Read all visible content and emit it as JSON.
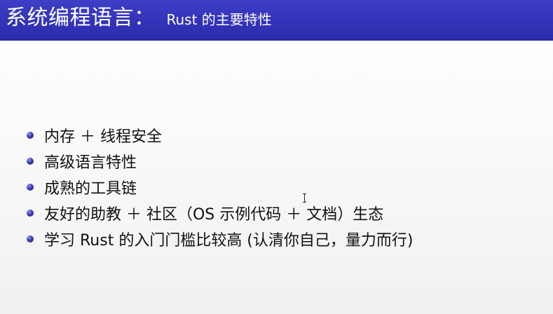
{
  "slide": {
    "title_main": "系统编程语言：",
    "title_sub": "Rust 的主要特性",
    "bullets": [
      "内存 ＋ 线程安全",
      "高级语言特性",
      "成熟的工具链",
      "友好的助教 ＋ 社区（OS 示例代码 ＋ 文档）生态",
      "学习 Rust 的入门门槛比较高 (认清你自己，量力而行)"
    ]
  },
  "colors": {
    "title_bar": "#3333b9",
    "bullet": "#3a3ab5",
    "text": "#111111"
  }
}
